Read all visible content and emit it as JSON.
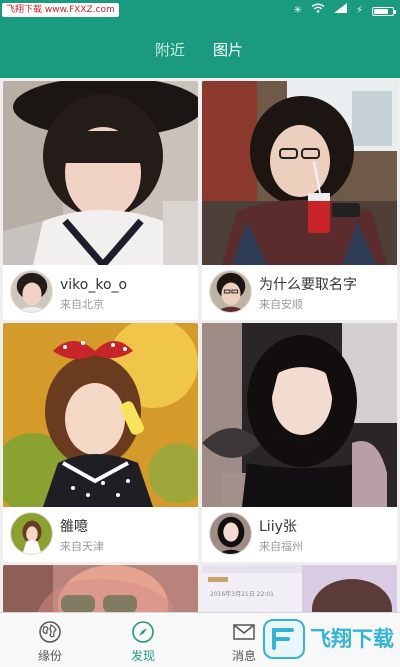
{
  "status_bar": {
    "watermark": "飞翔下载 www.FXXZ.com",
    "icons": [
      "bluetooth-icon",
      "wifi-icon",
      "signal-icon",
      "charging-icon",
      "battery-icon"
    ]
  },
  "header": {
    "tabs": [
      {
        "label": "附近",
        "active": false
      },
      {
        "label": "图片",
        "active": true
      }
    ]
  },
  "cards": [
    {
      "name": "viko_ko_o",
      "location": "来自北京"
    },
    {
      "name": "为什么要取名字",
      "location": "来自安顺"
    },
    {
      "name": "雒噫",
      "location": "来自天津"
    },
    {
      "name": "Liiy张",
      "location": "来自福州"
    }
  ],
  "partial_row": {
    "screenshot_text": "2016年3月21日 22:01"
  },
  "bottom_nav": {
    "items": [
      {
        "label": "缘份",
        "icon": "globe-icon",
        "active": false
      },
      {
        "label": "发现",
        "icon": "compass-icon",
        "active": true
      },
      {
        "label": "消息",
        "icon": "envelope-icon",
        "active": false
      }
    ]
  },
  "site_logo": {
    "text": "飞翔下载"
  },
  "colors": {
    "primary": "#1a9a7f",
    "background": "#efefef",
    "active_nav": "#1a9a7f"
  }
}
